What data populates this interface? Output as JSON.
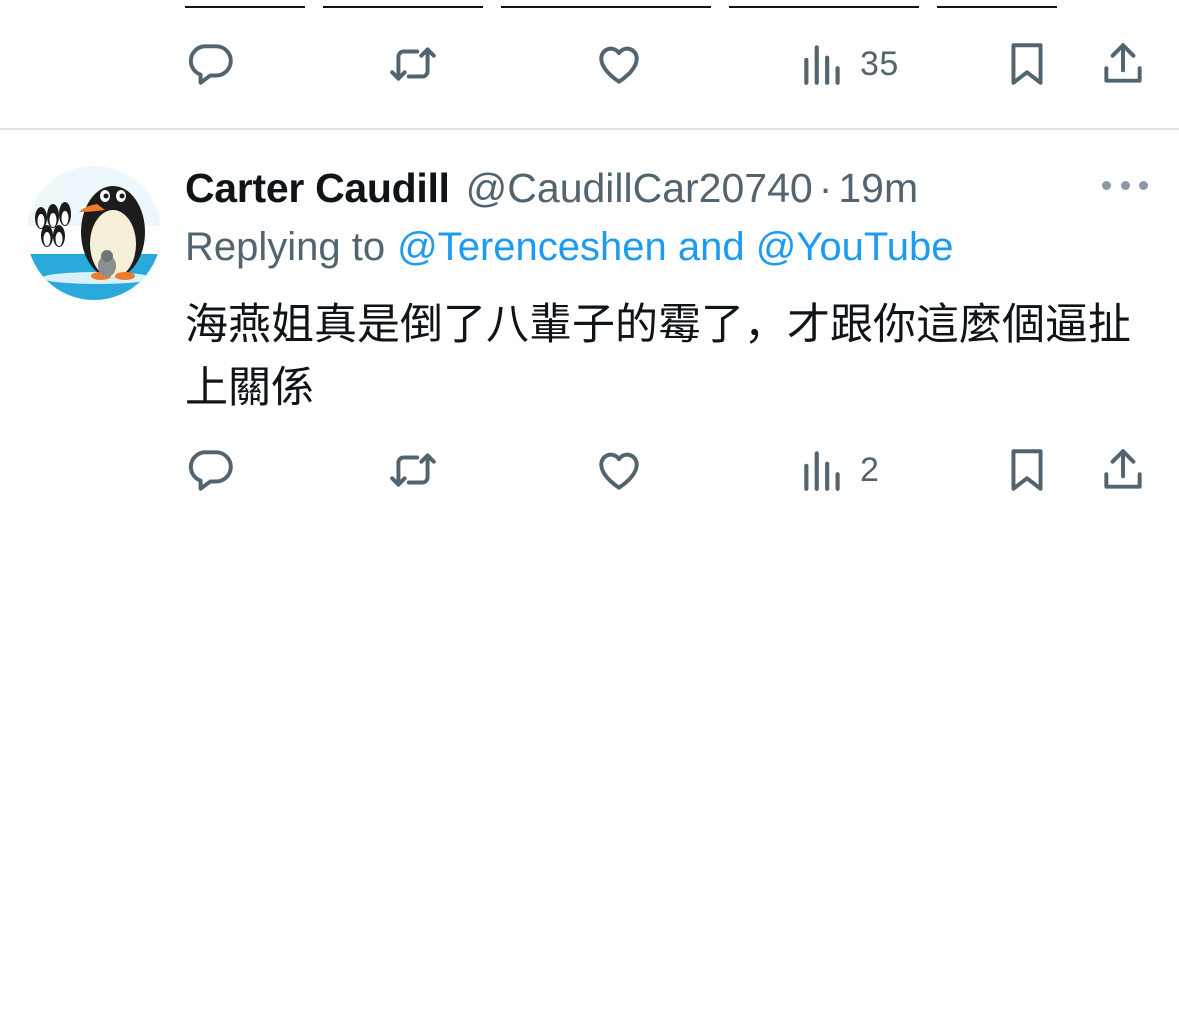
{
  "previous_tweet": {
    "actions": {
      "views_count": "35"
    }
  },
  "tweet": {
    "author_name": "Carter Caudill",
    "handle": "@CaudillCar20740",
    "separator": "·",
    "time": "19m",
    "replying_label": "Replying to",
    "replying_to": "@Terenceshen and @YouTube",
    "text": "海燕姐真是倒了八輩子的霉了，才跟你這麼個逼扯上關係",
    "actions": {
      "views_count": "2"
    }
  },
  "icons": {
    "reply": "reply-icon",
    "retweet": "retweet-icon",
    "like": "like-icon",
    "views": "views-icon",
    "bookmark": "bookmark-icon",
    "share": "share-icon",
    "more": "more-icon"
  },
  "colors": {
    "text_primary": "#0f1419",
    "text_secondary": "#536471",
    "link": "#1d9bf0",
    "divider": "#e1e6ea"
  }
}
